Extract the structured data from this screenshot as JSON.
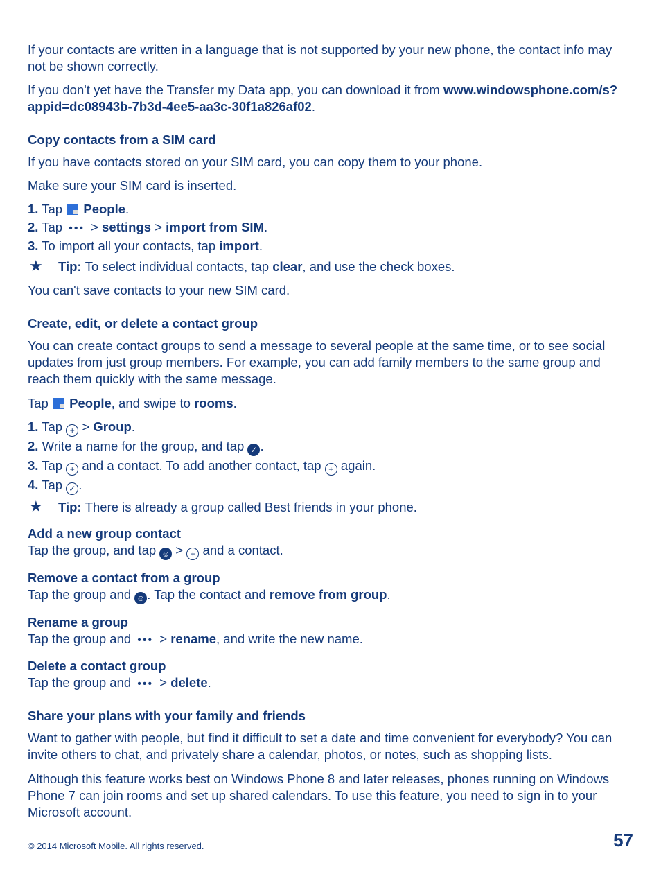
{
  "intro": {
    "para1": "If your contacts are written in a language that is not supported by your new phone, the contact info may not be shown correctly.",
    "para2_pre": "If you don't yet have the Transfer my Data app, you can download it from ",
    "para2_link": "www.windowsphone.com/s?appid=dc08943b-7b3d-4ee5-aa3c-30f1a826af02",
    "para2_post": "."
  },
  "sim": {
    "heading": "Copy contacts from a SIM card",
    "para1": "If you have contacts stored on your SIM card, you can copy them to your phone.",
    "para2": "Make sure your SIM card is inserted.",
    "step1_num": "1.",
    "step1_a": " Tap ",
    "step1_people": " People",
    "step1_end": ".",
    "step2_num": "2.",
    "step2_a": " Tap ",
    "dots": "•••",
    "step2_gt": " > ",
    "step2_settings": "settings",
    "step2_gt2": " > ",
    "step2_import": "import from SIM",
    "step2_end": ".",
    "step3_num": "3.",
    "step3_a": " To import all your contacts, tap ",
    "step3_import": "import",
    "step3_end": ".",
    "tip_label": "Tip: ",
    "tip_a": "To select individual contacts, tap ",
    "tip_clear": "clear",
    "tip_b": ", and use the check boxes.",
    "para3": "You can't save contacts to your new SIM card."
  },
  "group": {
    "heading": "Create, edit, or delete a contact group",
    "para1": "You can create contact groups to send a message to several people at the same time, or to see social updates from just group members. For example, you can add family members to the same group and reach them quickly with the same message.",
    "intro_a": "Tap ",
    "intro_people": " People",
    "intro_b": ", and swipe to ",
    "intro_rooms": "rooms",
    "intro_end": ".",
    "s1_num": "1.",
    "s1_a": " Tap ",
    "s1_gt": " > ",
    "s1_group": "Group",
    "s1_end": ".",
    "s2_num": "2.",
    "s2_a": " Write a name for the group, and tap ",
    "s2_end": ".",
    "s3_num": "3.",
    "s3_a": " Tap ",
    "s3_b": " and a contact. To add another contact, tap ",
    "s3_c": " again.",
    "s4_num": "4.",
    "s4_a": " Tap ",
    "s4_end": ".",
    "tip_label": "Tip: ",
    "tip_text": "There is already a group called Best friends in your phone.",
    "add_h": "Add a new group contact",
    "add_a": "Tap the group, and tap ",
    "add_gt": " > ",
    "add_b": " and a contact.",
    "rem_h": "Remove a contact from a group",
    "rem_a": "Tap the group and ",
    "rem_b": ". Tap the contact and ",
    "rem_bold": "remove from group",
    "rem_end": ".",
    "ren_h": "Rename a group",
    "ren_a": "Tap the group and ",
    "ren_gt": " > ",
    "ren_bold": "rename",
    "ren_b": ", and write the new name.",
    "del_h": "Delete a contact group",
    "del_a": "Tap the group and ",
    "del_gt": " > ",
    "del_bold": "delete",
    "del_end": "."
  },
  "share": {
    "heading": "Share your plans with your family and friends",
    "para1": "Want to gather with people, but find it difficult to set a date and time convenient for everybody? You can invite others to chat, and privately share a calendar, photos, or notes, such as shopping lists.",
    "para2": "Although this feature works best on Windows Phone 8 and later releases, phones running on Windows Phone 7 can join rooms and set up shared calendars. To use this feature, you need to sign in to your Microsoft account."
  },
  "footer": {
    "copyright": "© 2014 Microsoft Mobile. All rights reserved.",
    "page": "57"
  },
  "icons": {
    "plus": "+",
    "save": "✓",
    "group": "☺",
    "check": "✓"
  }
}
